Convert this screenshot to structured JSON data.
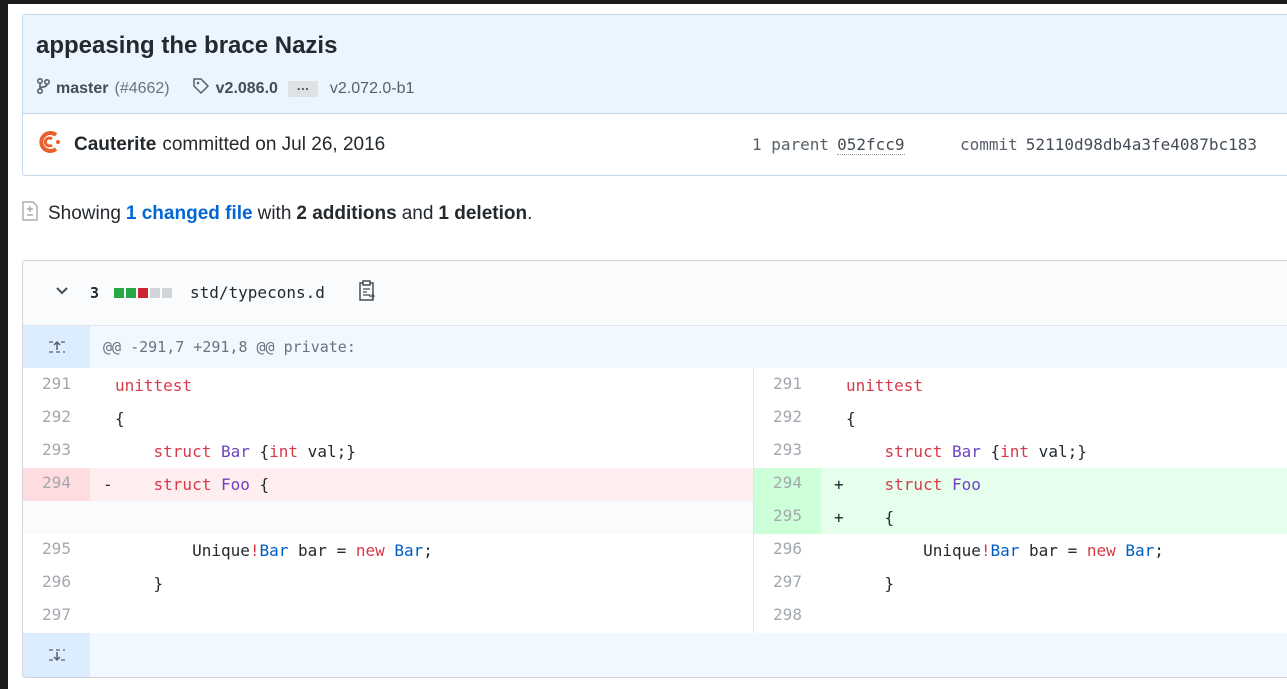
{
  "commit": {
    "title": "appeasing the brace Nazis",
    "branch": "master",
    "pr": "(#4662)",
    "tag_primary": "v2.086.0",
    "ellipsis": "…",
    "tag_secondary": "v2.072.0-b1",
    "author": "Cauterite",
    "action": "committed on Jul 26, 2016",
    "parent_label": "1 parent",
    "parent_sha": "052fcc9",
    "commit_label": "commit",
    "commit_sha": "52110d98db4a3fe4087bc183"
  },
  "summary": {
    "showing": "Showing",
    "changed": "1 changed file",
    "with": "with",
    "additions": "2 additions",
    "and": "and",
    "deletions": "1 deletion",
    "period": "."
  },
  "file": {
    "change_count": "3",
    "diffstat": [
      "#28a745",
      "#28a745",
      "#cb2431",
      "#d1d5da",
      "#d1d5da"
    ],
    "path": "std/typecons.d",
    "hunk_header": "@@ -291,7 +291,8 @@ private:"
  },
  "left_lines": [
    {
      "num": "291",
      "type": "ctx",
      "sign": "",
      "tokens": [
        {
          "t": "unittest",
          "c": "kw"
        }
      ]
    },
    {
      "num": "292",
      "type": "ctx",
      "sign": "",
      "tokens": [
        {
          "t": "{",
          "c": "pl"
        }
      ]
    },
    {
      "num": "293",
      "type": "ctx",
      "sign": "",
      "tokens": [
        {
          "t": "    ",
          "c": "pl"
        },
        {
          "t": "struct",
          "c": "kw"
        },
        {
          "t": " ",
          "c": "pl"
        },
        {
          "t": "Bar",
          "c": "ty"
        },
        {
          "t": " {",
          "c": "pl"
        },
        {
          "t": "int",
          "c": "kw"
        },
        {
          "t": " val;}",
          "c": "pl"
        }
      ]
    },
    {
      "num": "294",
      "type": "del",
      "sign": "-",
      "tokens": [
        {
          "t": "    ",
          "c": "pl"
        },
        {
          "t": "struct",
          "c": "kw"
        },
        {
          "t": " ",
          "c": "pl"
        },
        {
          "t": "Foo",
          "c": "ty"
        },
        {
          "t": " {",
          "c": "pl"
        }
      ]
    },
    {
      "num": "",
      "type": "empty",
      "sign": "",
      "tokens": []
    },
    {
      "num": "295",
      "type": "ctx",
      "sign": "",
      "tokens": [
        {
          "t": "        Unique",
          "c": "pl"
        },
        {
          "t": "!",
          "c": "kw"
        },
        {
          "t": "Bar",
          "c": "id"
        },
        {
          "t": " bar = ",
          "c": "pl"
        },
        {
          "t": "new",
          "c": "kw"
        },
        {
          "t": " ",
          "c": "pl"
        },
        {
          "t": "Bar",
          "c": "id"
        },
        {
          "t": ";",
          "c": "pl"
        }
      ]
    },
    {
      "num": "296",
      "type": "ctx",
      "sign": "",
      "tokens": [
        {
          "t": "    }",
          "c": "pl"
        }
      ]
    },
    {
      "num": "297",
      "type": "ctx",
      "sign": "",
      "tokens": []
    }
  ],
  "right_lines": [
    {
      "num": "291",
      "type": "ctx",
      "sign": "",
      "tokens": [
        {
          "t": "unittest",
          "c": "kw"
        }
      ]
    },
    {
      "num": "292",
      "type": "ctx",
      "sign": "",
      "tokens": [
        {
          "t": "{",
          "c": "pl"
        }
      ]
    },
    {
      "num": "293",
      "type": "ctx",
      "sign": "",
      "tokens": [
        {
          "t": "    ",
          "c": "pl"
        },
        {
          "t": "struct",
          "c": "kw"
        },
        {
          "t": " ",
          "c": "pl"
        },
        {
          "t": "Bar",
          "c": "ty"
        },
        {
          "t": " {",
          "c": "pl"
        },
        {
          "t": "int",
          "c": "kw"
        },
        {
          "t": " val;}",
          "c": "pl"
        }
      ]
    },
    {
      "num": "294",
      "type": "add",
      "sign": "+",
      "tokens": [
        {
          "t": "    ",
          "c": "pl"
        },
        {
          "t": "struct",
          "c": "kw"
        },
        {
          "t": " ",
          "c": "pl"
        },
        {
          "t": "Foo",
          "c": "ty"
        }
      ]
    },
    {
      "num": "295",
      "type": "add",
      "sign": "+",
      "tokens": [
        {
          "t": "    {",
          "c": "pl"
        }
      ]
    },
    {
      "num": "296",
      "type": "ctx",
      "sign": "",
      "tokens": [
        {
          "t": "        Unique",
          "c": "pl"
        },
        {
          "t": "!",
          "c": "kw"
        },
        {
          "t": "Bar",
          "c": "id"
        },
        {
          "t": " bar = ",
          "c": "pl"
        },
        {
          "t": "new",
          "c": "kw"
        },
        {
          "t": " ",
          "c": "pl"
        },
        {
          "t": "Bar",
          "c": "id"
        },
        {
          "t": ";",
          "c": "pl"
        }
      ]
    },
    {
      "num": "297",
      "type": "ctx",
      "sign": "",
      "tokens": [
        {
          "t": "    }",
          "c": "pl"
        }
      ]
    },
    {
      "num": "298",
      "type": "ctx",
      "sign": "",
      "tokens": []
    }
  ],
  "icons": {
    "branch": "git-branch-icon",
    "tag": "tag-icon",
    "avatar": "author-avatar",
    "diff": "file-diff-icon",
    "chevron": "chevron-down-icon",
    "copy": "clippy-icon",
    "expand_up": "unfold-up-icon",
    "expand_down": "unfold-down-icon"
  }
}
